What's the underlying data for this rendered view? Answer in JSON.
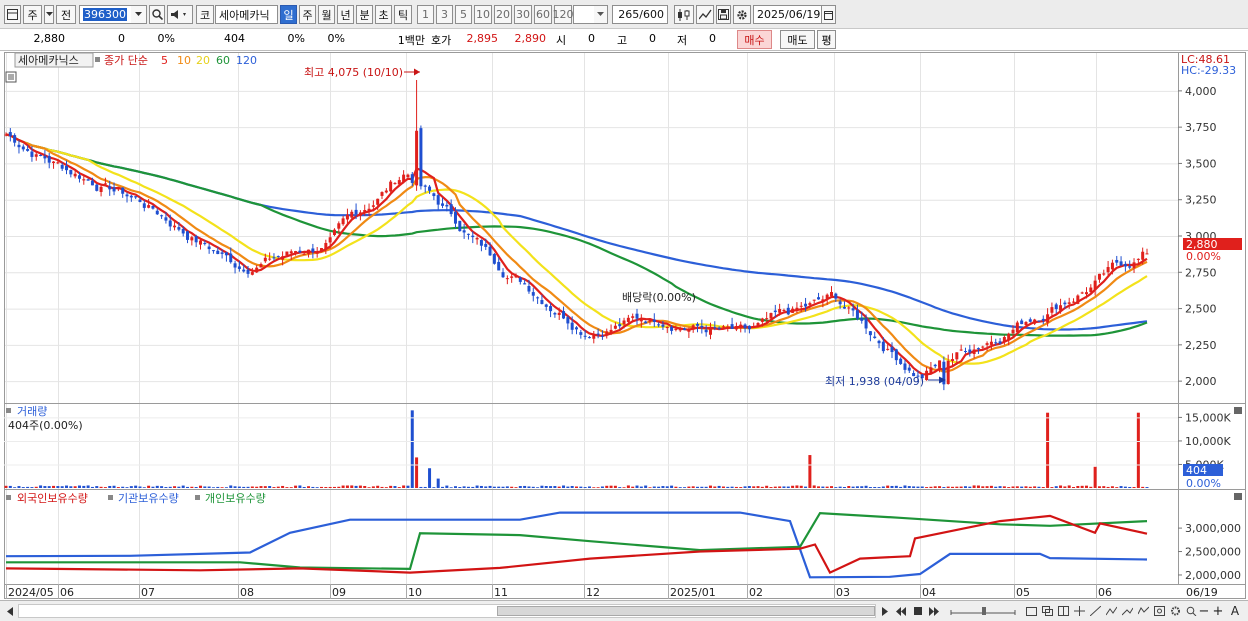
{
  "toolbar": {
    "market_btn": "주",
    "prev_btn": "전",
    "stock_code": "396300",
    "stock_name": "세아메카닉",
    "code_btn": "코",
    "periods": [
      "일",
      "주",
      "월",
      "년",
      "분",
      "초",
      "틱"
    ],
    "selected_period": "일",
    "intervals": [
      "1",
      "3",
      "5",
      "10",
      "20",
      "30",
      "60",
      "120"
    ],
    "count_value": "265",
    "count_total": "/600",
    "date_value": "2025/06/19"
  },
  "quote": {
    "price": "2,880",
    "change": "0",
    "change_pct": "0%",
    "volume": "404",
    "vol_pct1": "0%",
    "vol_pct2": "0%",
    "unit": "1백만",
    "bid_ask_label": "호가",
    "ask": "2,895",
    "bid": "2,890",
    "open_label": "시",
    "open": "0",
    "high_label": "고",
    "high": "0",
    "low_label": "저",
    "low": "0",
    "buy_btn": "매수",
    "sell_btn": "매도",
    "eval_btn": "평"
  },
  "price_panel": {
    "stock_label": "세아메카닉스",
    "ma_label": "종가 단순",
    "ma_periods": [
      "5",
      "10",
      "20",
      "60",
      "120"
    ],
    "ma_colors": [
      "#e0201c",
      "#f08a14",
      "#f3e21b",
      "#1e9438",
      "#2c5fd8"
    ],
    "lc_label": "LC:48.61",
    "hc_label": "HC:-29.33",
    "high_note": "최고 4,075 (10/10)",
    "low_note": "최저 1,938 (04/09)",
    "dividend_note": "배당락(0.00%)",
    "current_price_tag": "2,880",
    "current_pct_tag": "0.00%",
    "y_ticks": [
      "4,000",
      "3,750",
      "3,500",
      "3,250",
      "3,000",
      "2,750",
      "2,500",
      "2,250",
      "2,000"
    ]
  },
  "volume_panel": {
    "title": "거래량",
    "subtitle": "404주(0.00%)",
    "y_ticks": [
      "15,000K",
      "10,000K",
      "5,000K"
    ],
    "tag_value": "404",
    "tag_pct": "0.00%"
  },
  "holding_panel": {
    "legend": [
      "외국인보유수량",
      "기관보유수량",
      "개인보유수량"
    ],
    "legend_colors": [
      "#d21414",
      "#2c5fd8",
      "#1e9438"
    ],
    "y_ticks": [
      "3,000,000",
      "2,500,000",
      "2,000,000"
    ]
  },
  "x_axis": {
    "labels": [
      "2024/05",
      "06",
      "07",
      "08",
      "09",
      "10",
      "11",
      "12",
      "2025/01",
      "02",
      "03",
      "04",
      "05",
      "06"
    ],
    "end_label": "06/19"
  },
  "chart_data": {
    "type": "candlestick",
    "approx_close_by_month": [
      {
        "x": "2024/05",
        "close": 3700
      },
      {
        "x": "06",
        "close": 3500
      },
      {
        "x": "07",
        "close": 3250
      },
      {
        "x": "08",
        "close": 2800
      },
      {
        "x": "09",
        "close": 2950
      },
      {
        "x": "10",
        "close": 3450
      },
      {
        "x": "11",
        "close": 2850
      },
      {
        "x": "12",
        "close": 2400
      },
      {
        "x": "2025/01",
        "close": 2450
      },
      {
        "x": "02",
        "close": 2300
      },
      {
        "x": "03",
        "close": 2550
      },
      {
        "x": "04",
        "close": 2050
      },
      {
        "x": "05",
        "close": 2400
      },
      {
        "x": "06/19",
        "close": 2880
      }
    ],
    "annotations": {
      "high": 4075,
      "high_date": "10/10",
      "low": 1938,
      "low_date": "04/09"
    },
    "y_range": [
      1870,
      4130
    ]
  }
}
